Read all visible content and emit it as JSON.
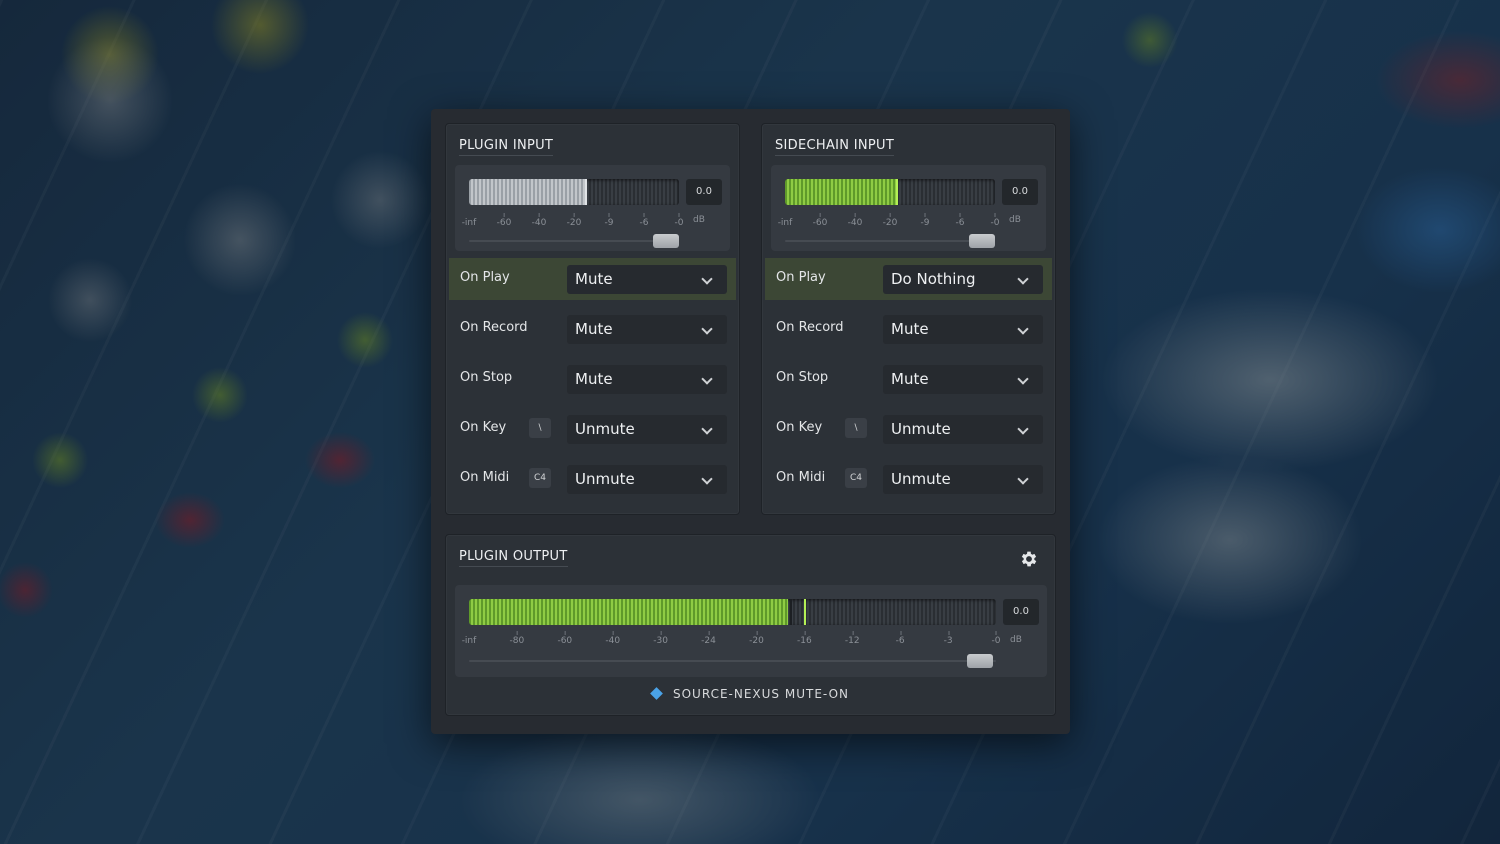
{
  "plugin_input": {
    "title": "PLUGIN INPUT",
    "meter": {
      "value_label": "0.0",
      "level": 0.55,
      "fill": "gray",
      "peak": 0.55,
      "slider": 0.94
    },
    "ticks": [
      "-inf",
      "-60",
      "-40",
      "-20",
      "-9",
      "-6",
      "-0"
    ],
    "db": "dB",
    "rows": [
      {
        "label": "On Play",
        "key": "",
        "value": "Mute",
        "active": true
      },
      {
        "label": "On Record",
        "key": "",
        "value": "Mute",
        "active": false
      },
      {
        "label": "On Stop",
        "key": "",
        "value": "Mute",
        "active": false
      },
      {
        "label": "On Key",
        "key": "\\",
        "value": "Unmute",
        "active": false
      },
      {
        "label": "On Midi",
        "key": "C4",
        "value": "Unmute",
        "active": false
      }
    ]
  },
  "sidechain_input": {
    "title": "SIDECHAIN INPUT",
    "meter": {
      "value_label": "0.0",
      "level": 0.53,
      "fill": "green",
      "peak": 0.53,
      "slider": 0.94
    },
    "ticks": [
      "-inf",
      "-60",
      "-40",
      "-20",
      "-9",
      "-6",
      "-0"
    ],
    "db": "dB",
    "rows": [
      {
        "label": "On Play",
        "key": "",
        "value": "Do Nothing",
        "active": true
      },
      {
        "label": "On Record",
        "key": "",
        "value": "Mute",
        "active": false
      },
      {
        "label": "On Stop",
        "key": "",
        "value": "Mute",
        "active": false
      },
      {
        "label": "On Key",
        "key": "\\",
        "value": "Unmute",
        "active": false
      },
      {
        "label": "On Midi",
        "key": "C4",
        "value": "Unmute",
        "active": false
      }
    ]
  },
  "plugin_output": {
    "title": "PLUGIN OUTPUT",
    "meter": {
      "value_label": "0.0",
      "level": 0.605,
      "fill": "green",
      "peak": 0.635,
      "slider": 0.97
    },
    "ticks": [
      "-inf",
      "-80",
      "-60",
      "-40",
      "-30",
      "-24",
      "-20",
      "-16",
      "-12",
      "-6",
      "-3",
      "-0"
    ],
    "db": "dB",
    "footer": "SOURCE-NEXUS MUTE-ON",
    "icons": {
      "settings": "gear-icon",
      "brand": "diamond-icon"
    },
    "brand_color": "#4aa3e8"
  }
}
